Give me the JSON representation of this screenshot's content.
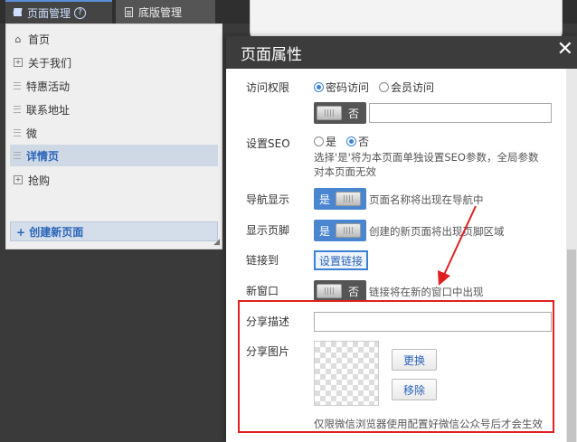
{
  "tabs": [
    {
      "label": "页面管理",
      "icon": "layers-icon",
      "help": "?"
    },
    {
      "label": "底版管理",
      "icon": "document-icon"
    }
  ],
  "sidebar": {
    "items": [
      {
        "label": "首页",
        "icon": "home-icon"
      },
      {
        "label": "关于我们",
        "icon": "expand-icon"
      },
      {
        "label": "特惠活动",
        "icon": "lines-icon"
      },
      {
        "label": "联系地址",
        "icon": "lines-icon"
      },
      {
        "label": "微",
        "icon": "lines-icon"
      },
      {
        "label": "详情页",
        "icon": "lines-icon",
        "active": true
      },
      {
        "label": "抢购",
        "icon": "expand-icon"
      }
    ],
    "create_button": "+ 创建新页面"
  },
  "dialog": {
    "title": "页面属性",
    "close": "✕",
    "access": {
      "label": "访问权限",
      "options": [
        "密码访问",
        "会员访问"
      ],
      "selected": "密码访问",
      "toggle_label": "否",
      "password_value": ""
    },
    "seo": {
      "label": "设置SEO",
      "options": [
        "是",
        "否"
      ],
      "selected": "否",
      "hint_line1": "选择'是'将为本页面单独设置SEO参数，全局参数",
      "hint_line2": "对本页面无效"
    },
    "nav_show": {
      "label": "导航显示",
      "toggle_label": "是",
      "hint": "页面名称将出现在导航中"
    },
    "footer_show": {
      "label": "显示页脚",
      "toggle_label": "是",
      "hint": "创建的新页面将出现页脚区域"
    },
    "link_to": {
      "label": "链接到",
      "button": "设置链接"
    },
    "new_window": {
      "label": "新窗口",
      "toggle_label": "否",
      "hint": "链接将在新的窗口中出现"
    },
    "share_desc": {
      "label": "分享描述",
      "value": ""
    },
    "share_image": {
      "label": "分享图片",
      "replace_button": "更换",
      "remove_button": "移除",
      "note": "仅限微信浏览器使用配置好微信公众号后才会生效"
    }
  },
  "annotation": {
    "color": "#e02020"
  }
}
